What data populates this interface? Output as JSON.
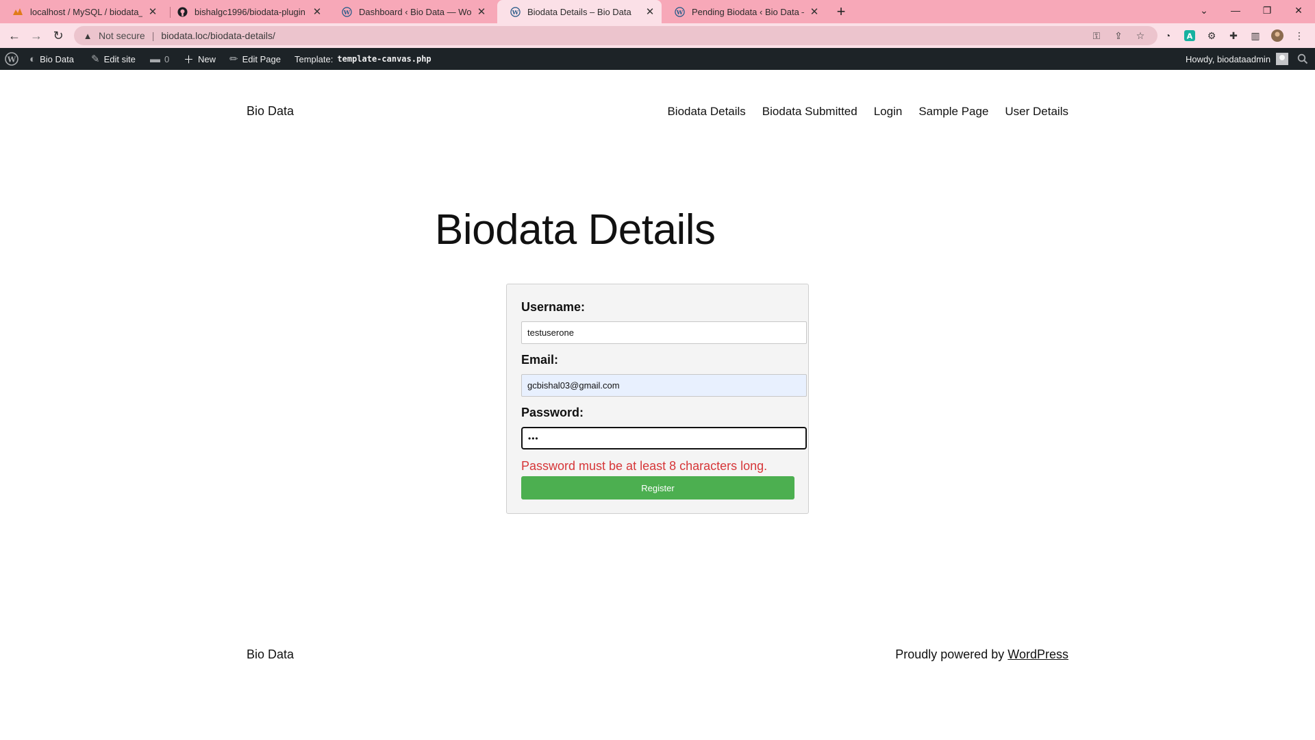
{
  "browser": {
    "tabs": [
      {
        "title": "localhost / MySQL / biodata_db /",
        "icon": "phpmyadmin-icon",
        "active": false
      },
      {
        "title": "bishalgc1996/biodata-plugin",
        "icon": "github-icon",
        "active": false
      },
      {
        "title": "Dashboard ‹ Bio Data — WordPress",
        "icon": "wordpress-icon",
        "active": false
      },
      {
        "title": "Biodata Details – Bio Data",
        "icon": "wordpress-icon",
        "active": true
      },
      {
        "title": "Pending Biodata ‹ Bio Data — WordPress",
        "icon": "wordpress-icon",
        "active": false
      }
    ],
    "security_label": "Not secure",
    "url": "biodata.loc/biodata-details/",
    "tab_color": "#f7a8b8"
  },
  "admin_bar": {
    "site_name": "Bio Data",
    "edit_site": "Edit site",
    "comments_count": "0",
    "new_label": "New",
    "edit_page": "Edit Page",
    "template_label": "Template:",
    "template_name": "template-canvas.php",
    "greeting": "Howdy, biodataadmin"
  },
  "header": {
    "site_title": "Bio Data",
    "nav": [
      "Biodata Details",
      "Biodata Submitted",
      "Login",
      "Sample Page",
      "User Details"
    ]
  },
  "main": {
    "title": "Biodata Details",
    "form": {
      "username_label": "Username:",
      "username_value": "testuserone",
      "email_label": "Email:",
      "email_value": "gcbishal03@gmail.com",
      "password_label": "Password:",
      "password_value": "•••",
      "error_message": "Password must be at least 8 characters long.",
      "submit_label": "Register"
    },
    "colors": {
      "error": "#d63638",
      "button": "#4caf50"
    }
  },
  "footer": {
    "site_title": "Bio Data",
    "credit_prefix": "Proudly powered by",
    "credit_link": "WordPress"
  }
}
